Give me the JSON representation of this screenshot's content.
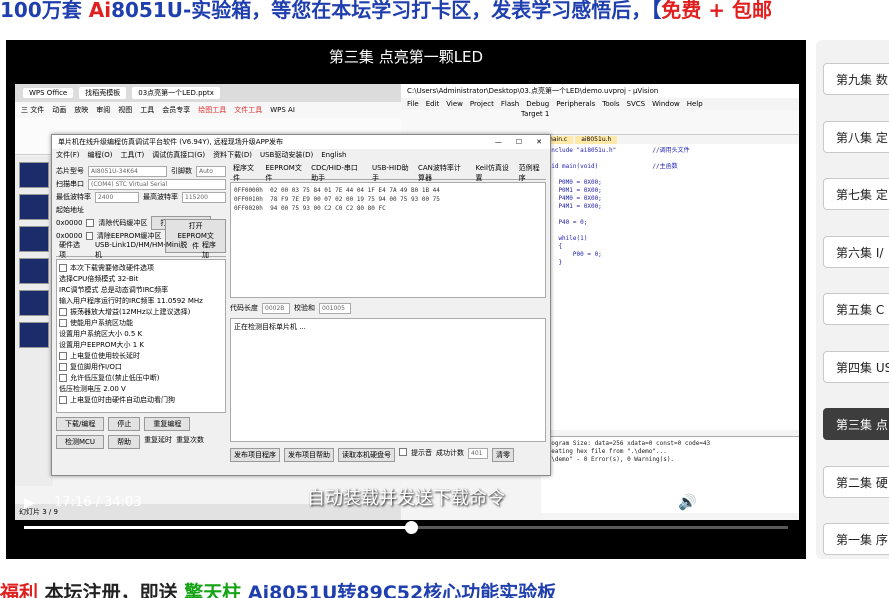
{
  "banner": {
    "part1": "100万套 ",
    "part2": "Ai",
    "part3": "8051U-实验箱，等您在本坛学习打卡区，发表学习感悟后，【",
    "part4": "免费",
    "part5": " + 包邮"
  },
  "video": {
    "title": "第三集 点亮第一颗LED",
    "subtitle": "自动装载并发送下载命令",
    "current_time": "17:16",
    "duration": "34:03",
    "time_separator": " / ",
    "progress": 0.507
  },
  "screen": {
    "wps": {
      "tabs": [
        "WPS Office",
        "找稻壳模板",
        "03点亮第一个LED.pptx"
      ],
      "menu": [
        "三 文件",
        "动画",
        "放映",
        "审阅",
        "视图",
        "工具",
        "会员专享",
        "绘图工具",
        "文件工具",
        "WPS AI"
      ],
      "status": "幻灯片 3 / 9"
    },
    "stc": {
      "title": "单片机在线升级编程仿真调试平台软件 (V6.94Y), 远程现场升级APP发布",
      "menu": [
        "文件(F)",
        "编程(O)",
        "工具(T)",
        "调试仿真接口(G)",
        "资料下载(D)",
        "USB驱动安装(D)",
        "English"
      ],
      "chip_label": "芯片型号",
      "chip_value": "AI8051U-34K64",
      "pins_label": "引脚数",
      "pins_value": "Auto",
      "port_label": "扫描串口",
      "port_value": "(COM4) STC Virtual Serial",
      "min_baud_label": "最低波特率",
      "min_baud": "2400",
      "max_baud_label": "最高波特率",
      "max_baud": "115200",
      "addr_title": "起始地址",
      "addr1": "0x0000",
      "addr2": "0x0000",
      "addr1_opt": "清除代码缓冲区",
      "addr2_opt": "清除EEPROM缓冲区",
      "open_prog": "打开程序文件",
      "open_eeprom": "打开EEPROM文件",
      "left_tabs": [
        "硬件选项",
        "USB-Link1D/HM/HM-Mini脱机",
        "程序加"
      ],
      "options": [
        "本次下载需要修改硬件选项",
        "选择CPU倍频模式  32-Bit",
        "IRC调节模式  总是动态调节IRC频率",
        "输入用户程序运行时的IRC频率  11.0592  MHz",
        "振荡器放大增益(12MHz以上建议选择)",
        "使能用户系统区功能",
        "设置用户系统区大小  0.5 K",
        "设置用户EEPROM大小  1 K",
        "上电复位使用较长延时",
        "复位脚用作I/O口",
        "允许低压复位(禁止低压中断)",
        "低压检测电压  2.00 V",
        "上电复位时由硬件自动启动看门狗"
      ],
      "btn_download": "下载/编程",
      "btn_stop": "停止",
      "btn_redownload": "重复编程",
      "btn_check": "检测MCU",
      "btn_help": "帮助",
      "repeat_delay": "重复延时",
      "repeat_count": "重复次数",
      "right_tabs": [
        "程序文件",
        "EEPROM文件",
        "CDC/HID-串口助手",
        "USB-HID助手",
        "CAN波特率计算器",
        "Keil仿真设置",
        "范例程序"
      ],
      "hex_lines": [
        "0FF0000h  02 00 03 75 84 01 7E 44 04 1F E4 7A 49 B0 1B 44",
        "0FF0010h  78 F9 7E E9 00 07 02 00 19 75 94 00 75 93 00 75",
        "0FF0020h  94 00 75 93 00 C2 C0 C2 80 80 FC"
      ],
      "code_len_label": "代码长度",
      "code_len": "0002B",
      "checksum_label": "校验和",
      "checksum": "001005",
      "log_text": "正在检测目标单片机 ...",
      "bottom_btns": [
        "发布项目程序",
        "发布项目帮助",
        "读取本机硬盘号",
        "提示音",
        "成功计数"
      ],
      "success_count": "401",
      "clear_btn": "清零"
    },
    "keil": {
      "title": "C:\\Users\\Administrator\\Desktop\\03.点亮第一个LED\\demo.uvproj - µVision",
      "menu": [
        "File",
        "Edit",
        "View",
        "Project",
        "Flash",
        "Debug",
        "Peripherals",
        "Tools",
        "SVCS",
        "Window",
        "Help"
      ],
      "target": "Target 1",
      "tabs": [
        "main.c",
        "ai8051u.h"
      ],
      "code_lines": [
        "#include \"ai8051u.h\"          //调用头文件",
        "",
        "void main(void)               //主函数",
        "{",
        "    P0M0 = 0X00;",
        "    P0M1 = 0X00;",
        "    P4M0 = 0X00;",
        "    P4M1 = 0X00;",
        "",
        "    P40 = 0;",
        "",
        "    while(1)",
        "    {",
        "        P00 = 0;",
        "    }",
        "}"
      ],
      "build_lines": [
        "Program Size: data=256 xdata=0 const=0 code=43",
        "creating hex file from \".\\demo\"...",
        "\".\\demo\" - 0 Error(s), 0 Warning(s)."
      ]
    }
  },
  "playlist": {
    "items": [
      "第九集 数",
      "第八集 定",
      "第七集 定",
      "第六集 I/",
      "第五集 C",
      "第四集 US",
      "第三集 点",
      "第二集 硬",
      "第一集 序"
    ],
    "active_index": 6
  },
  "footer": {
    "part1": "福利",
    "part2": " 本坛注册，即送 ",
    "part3": "擎天柱",
    "part4": " Ai8051U转89C52核心功能实验板"
  }
}
